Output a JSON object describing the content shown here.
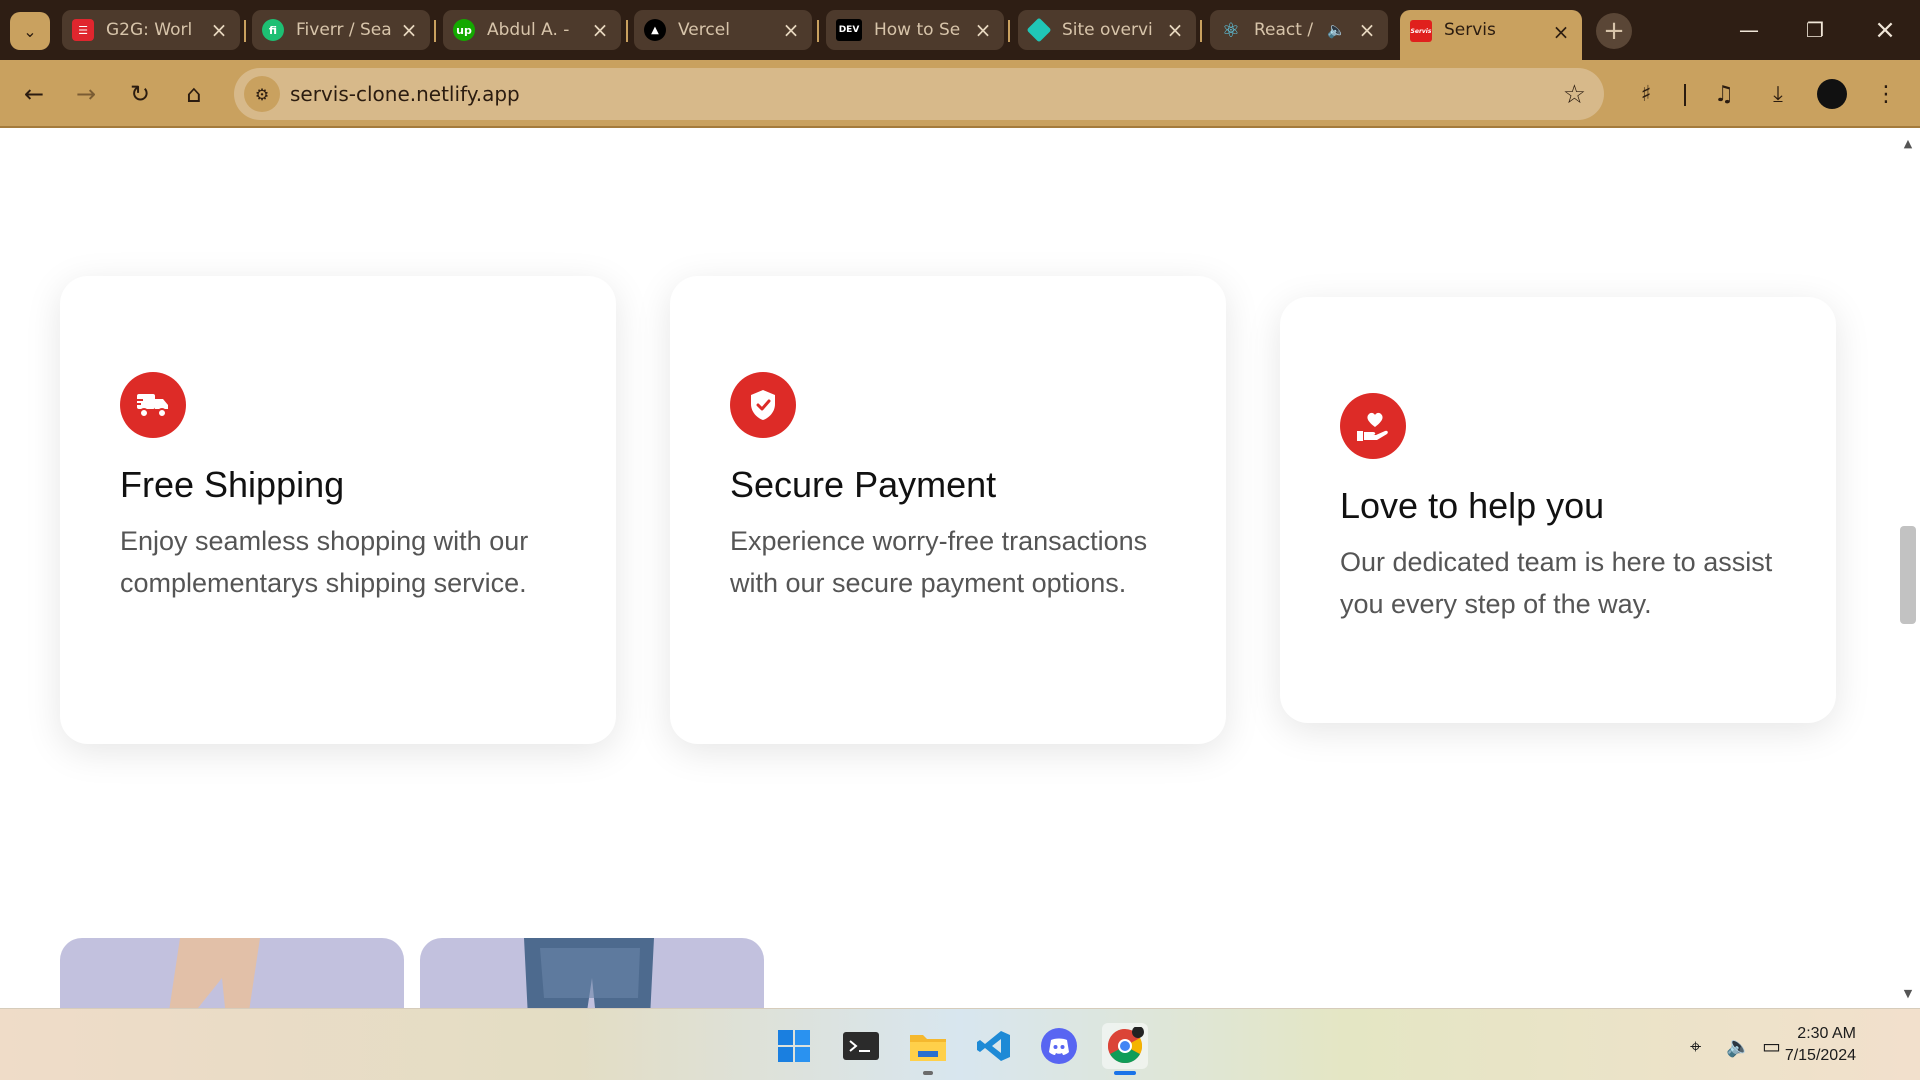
{
  "browser": {
    "tabs": [
      {
        "title": "G2G: Worl",
        "favicon": "g2g-icon"
      },
      {
        "title": "Fiverr / Sea",
        "favicon": "fiverr-icon"
      },
      {
        "title": "Abdul A. -",
        "favicon": "upwork-icon"
      },
      {
        "title": "Vercel",
        "favicon": "vercel-icon"
      },
      {
        "title": "How to Se",
        "favicon": "dev-icon"
      },
      {
        "title": "Site overvi",
        "favicon": "netlify-icon"
      },
      {
        "title": "React /",
        "favicon": "react-icon",
        "audio": true
      },
      {
        "title": "Servis",
        "favicon": "servis-icon",
        "active": true
      }
    ],
    "favicon_labels": {
      "fiverr": "fi",
      "upwork": "up",
      "dev": "DEV",
      "servis": "Servis"
    },
    "url": "servis-clone.netlify.app",
    "colors": {
      "frame": "#2e1e14",
      "toolbar": "#c9a15f",
      "accent": "#dd2b27"
    }
  },
  "features": [
    {
      "icon": "truck-icon",
      "title": "Free Shipping",
      "text": "Enjoy seamless shopping with our complementarys shipping service."
    },
    {
      "icon": "shield-check-icon",
      "title": "Secure Payment",
      "text": "Experience worry-free transactions with our secure payment options."
    },
    {
      "icon": "heart-hand-icon",
      "title": "Love to help you",
      "text": "Our dedicated team is here to assist you every step of the way."
    }
  ],
  "taskbar": {
    "apps": [
      "windows-start-icon",
      "terminal-icon",
      "file-explorer-icon",
      "vscode-icon",
      "discord-icon",
      "chrome-icon"
    ],
    "clock": {
      "time": "2:30 AM",
      "date": "7/15/2024"
    }
  }
}
